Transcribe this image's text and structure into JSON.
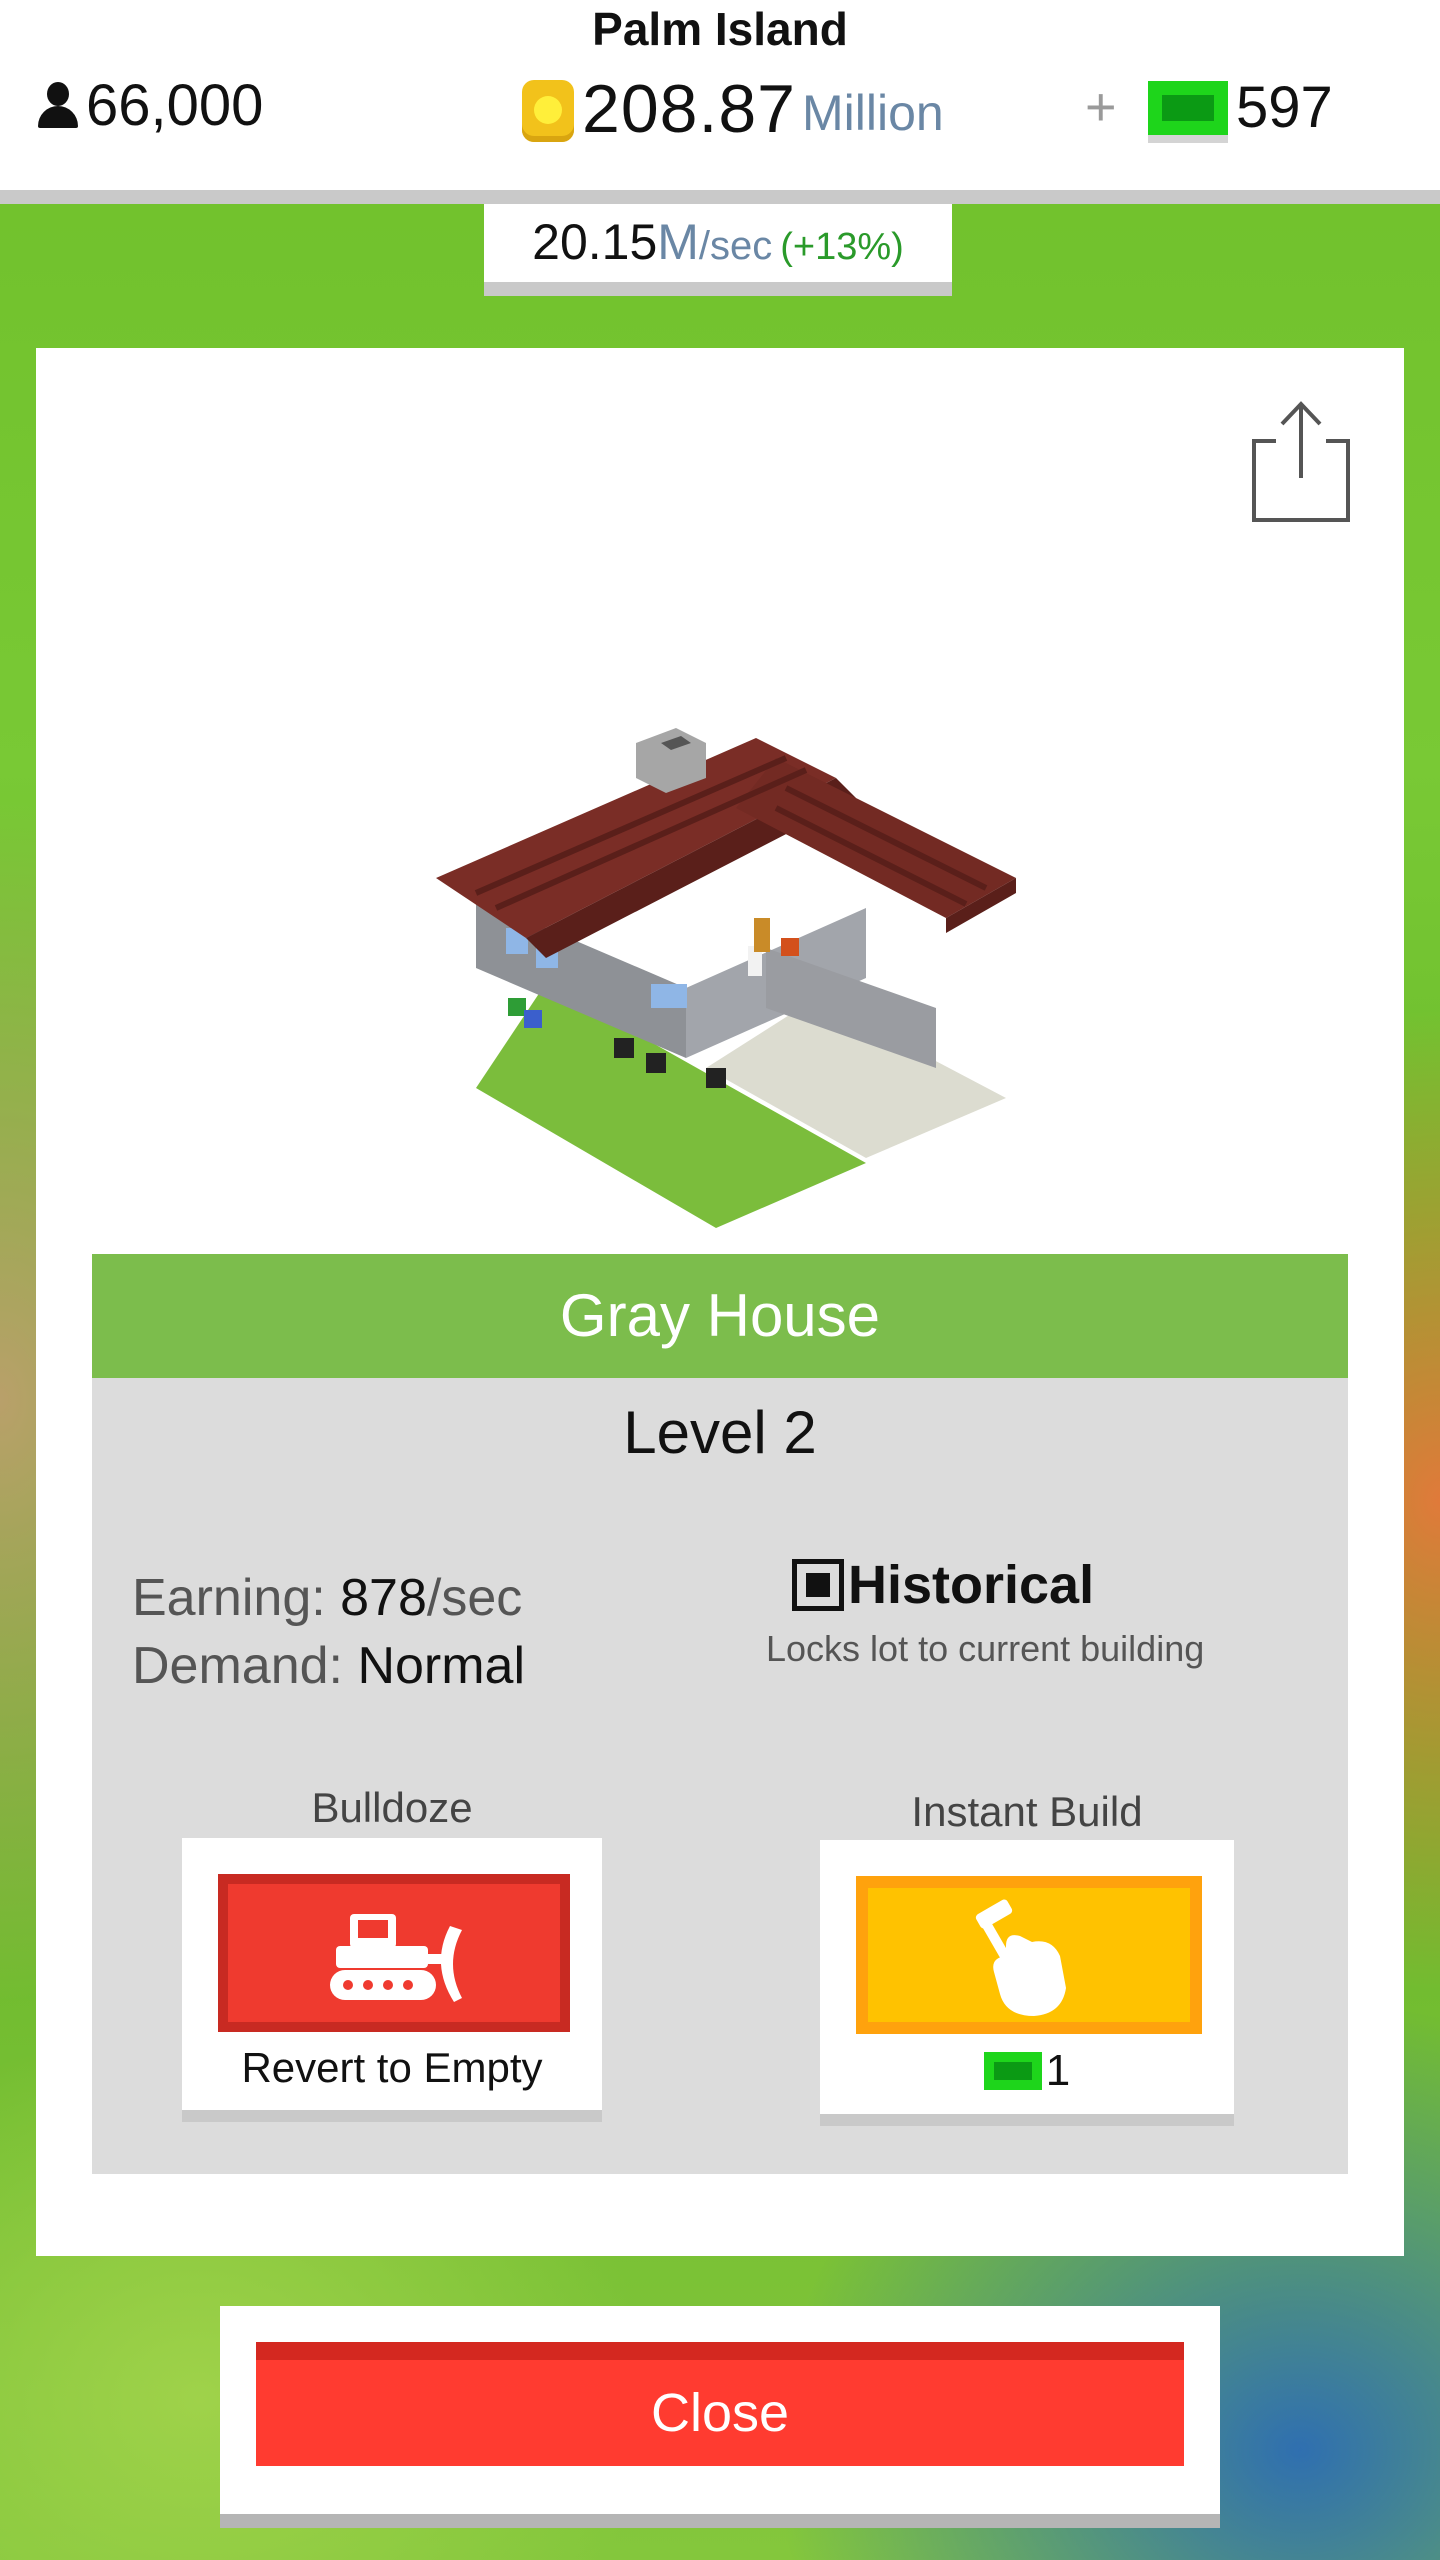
{
  "header": {
    "island_name": "Palm Island",
    "population": "66,000",
    "coins_value": "208.87",
    "coins_unit": "Million",
    "plus_symbol": "+",
    "cash_value": "597",
    "rate_value": "20.15",
    "rate_unit_m": "M",
    "rate_unit_sec": "/sec",
    "rate_bonus": "(+13%)"
  },
  "building": {
    "name": "Gray House",
    "level": "Level 2",
    "earning_label": "Earning:",
    "earning_value": "878",
    "earning_unit": "/sec",
    "demand_label": "Demand:",
    "demand_value": "Normal",
    "historical_label": "Historical",
    "historical_checked": true,
    "historical_desc": "Locks lot to current building"
  },
  "actions": {
    "bulldoze_title": "Bulldoze",
    "bulldoze_label": "Revert to Empty",
    "instant_title": "Instant Build",
    "instant_cost": "1"
  },
  "footer": {
    "close_label": "Close"
  },
  "colors": {
    "banner_green": "#7cbd4c",
    "bulldoze_red": "#ef3a2f",
    "instant_yellow": "#ffc200",
    "close_red": "#ff3b30",
    "cash_green": "#1ed51b"
  },
  "icons": [
    "person-icon",
    "coin-icon",
    "cash-icon",
    "share-icon",
    "bulldozer-icon",
    "hammer-hand-icon"
  ]
}
